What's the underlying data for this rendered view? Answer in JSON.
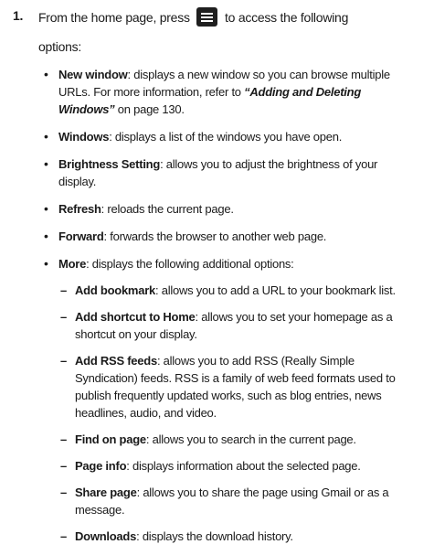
{
  "step": {
    "number": "1.",
    "text_before": "From the home page, press",
    "text_after": "to access the following",
    "text_line2": "options:",
    "icon": "menu-key-icon"
  },
  "bullets": [
    {
      "term": "New window",
      "desc": ": displays a new window so you can browse multiple URLs. For more information, refer to ",
      "ref": "“Adding and Deleting Windows”",
      "ref_page": " on page 130."
    },
    {
      "term": "Windows",
      "desc": ": displays a list of the windows you have open."
    },
    {
      "term": "Brightness Setting",
      "desc": ": allows you to adjust the brightness of your display."
    },
    {
      "term": "Refresh",
      "desc": ": reloads the current page."
    },
    {
      "term": "Forward",
      "desc": ": forwards the browser to another web page."
    },
    {
      "term": "More",
      "desc": ": displays the following additional options:"
    }
  ],
  "more_options": [
    {
      "term": "Add bookmark",
      "desc": ": allows you to add a URL to your bookmark list."
    },
    {
      "term": "Add shortcut to Home",
      "desc": ": allows you to set your homepage as a shortcut on your display."
    },
    {
      "term": "Add RSS feeds",
      "desc": ": allows you to add RSS (Really Simple Syndication) feeds. RSS is a family of web feed formats used to publish frequently updated works, such as blog entries, news headlines, audio, and video."
    },
    {
      "term": "Find on page",
      "desc": ": allows you to search in the current page."
    },
    {
      "term": "Page info",
      "desc": ": displays information about the selected page."
    },
    {
      "term": "Share page",
      "desc": ": allows you to share the page using Gmail or as a message."
    },
    {
      "term": "Downloads",
      "desc": ": displays the download history."
    }
  ]
}
